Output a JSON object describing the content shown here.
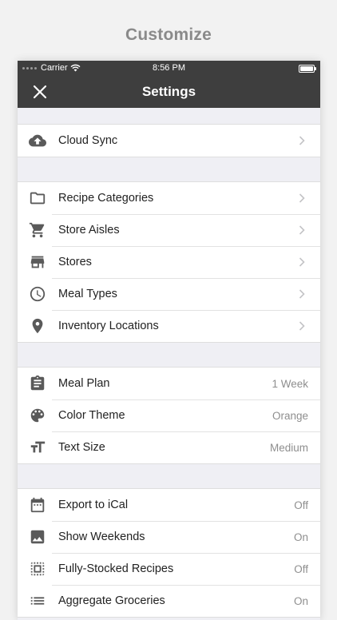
{
  "headline": "Customize",
  "status_bar": {
    "carrier": "Carrier",
    "time": "8:56 PM"
  },
  "navbar": {
    "title": "Settings"
  },
  "sections": [
    [
      {
        "icon": "cloud-upload-icon",
        "label": "Cloud Sync",
        "value": null
      }
    ],
    [
      {
        "icon": "folder-icon",
        "label": "Recipe Categories",
        "value": null
      },
      {
        "icon": "cart-icon",
        "label": "Store Aisles",
        "value": null
      },
      {
        "icon": "store-icon",
        "label": "Stores",
        "value": null
      },
      {
        "icon": "clock-icon",
        "label": "Meal Types",
        "value": null
      },
      {
        "icon": "location-pin-icon",
        "label": "Inventory Locations",
        "value": null
      }
    ],
    [
      {
        "icon": "clipboard-icon",
        "label": "Meal Plan",
        "value": "1 Week"
      },
      {
        "icon": "palette-icon",
        "label": "Color Theme",
        "value": "Orange"
      },
      {
        "icon": "text-size-icon",
        "label": "Text Size",
        "value": "Medium"
      }
    ],
    [
      {
        "icon": "calendar-icon",
        "label": "Export to iCal",
        "value": "Off"
      },
      {
        "icon": "image-icon",
        "label": "Show Weekends",
        "value": "On"
      },
      {
        "icon": "select-all-icon",
        "label": "Fully-Stocked Recipes",
        "value": "Off"
      },
      {
        "icon": "list-icon",
        "label": "Aggregate Groceries",
        "value": "On"
      }
    ]
  ]
}
